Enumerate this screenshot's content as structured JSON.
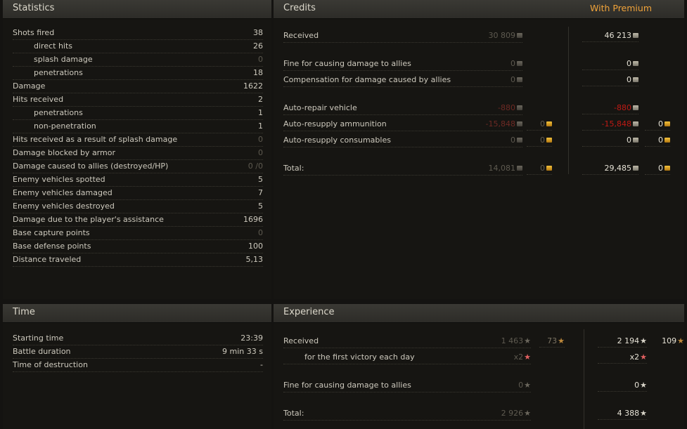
{
  "statistics": {
    "title": "Statistics",
    "rows": [
      {
        "label": "Shots fired",
        "value": "38"
      },
      {
        "label": "direct hits",
        "value": "26"
      },
      {
        "label": "splash damage",
        "value": "0"
      },
      {
        "label": "penetrations",
        "value": "18"
      },
      {
        "label": "Damage",
        "value": "1622"
      },
      {
        "label": "Hits received",
        "value": "2"
      },
      {
        "label": "penetrations",
        "value": "1"
      },
      {
        "label": "non-penetration",
        "value": "1"
      },
      {
        "label": "Hits received as a result of splash damage",
        "value": "0"
      },
      {
        "label": "Damage blocked by armor",
        "value": "0"
      },
      {
        "label": "Damage caused to allies (destroyed/HP)",
        "value": "0 /0"
      },
      {
        "label": "Enemy vehicles spotted",
        "value": "5"
      },
      {
        "label": "Enemy vehicles damaged",
        "value": "7"
      },
      {
        "label": "Enemy vehicles destroyed",
        "value": "5"
      },
      {
        "label": "Damage due to the player's assistance",
        "value": "1696"
      },
      {
        "label": "Base capture points",
        "value": "0"
      },
      {
        "label": "Base defense points",
        "value": "100"
      },
      {
        "label": "Distance traveled",
        "value": "5,13"
      }
    ]
  },
  "credits": {
    "title": "Credits",
    "premium_title": "With Premium",
    "rows": [
      {
        "label": "Received",
        "base": "30 809",
        "premium": "46 213"
      },
      {
        "label": "Fine for causing damage to allies",
        "base": "0",
        "premium": "0"
      },
      {
        "label": "Compensation for damage caused by allies",
        "base": "0",
        "premium": "0"
      },
      {
        "label": "Auto-repair vehicle",
        "base": "-880",
        "premium": "-880"
      },
      {
        "label": "Auto-resupply ammunition",
        "base": "-15,848",
        "base_gold": "0",
        "premium": "-15,848",
        "premium_gold": "0"
      },
      {
        "label": "Auto-resupply consumables",
        "base": "0",
        "base_gold": "0",
        "premium": "0",
        "premium_gold": "0"
      },
      {
        "label": "Total:",
        "base": "14,081",
        "base_gold": "0",
        "premium": "29,485",
        "premium_gold": "0"
      }
    ]
  },
  "time": {
    "title": "Time",
    "rows": [
      {
        "label": "Starting time",
        "value": "23:39"
      },
      {
        "label": "Battle duration",
        "value": "9 min 33 s"
      },
      {
        "label": "Time of destruction",
        "value": "-"
      }
    ]
  },
  "experience": {
    "title": "Experience",
    "rows": [
      {
        "label": "Received",
        "base": "1 463",
        "base_free": "73",
        "premium": "2 194",
        "premium_free": "109"
      },
      {
        "label": "for the first victory each day",
        "base": "x2",
        "premium": "x2"
      },
      {
        "label": "Fine for causing damage to allies",
        "base": "0",
        "premium": "0"
      },
      {
        "label": "Total:",
        "base": "2 926",
        "premium": "4 388"
      }
    ]
  },
  "icons": {
    "credits": "credits-icon",
    "gold": "gold-icon",
    "experience": "star-icon",
    "free_experience": "free-xp-star-icon"
  },
  "colors": {
    "premium_title": "#f0a33a",
    "negative": "#c01a14",
    "gold": "#f4c23c"
  }
}
